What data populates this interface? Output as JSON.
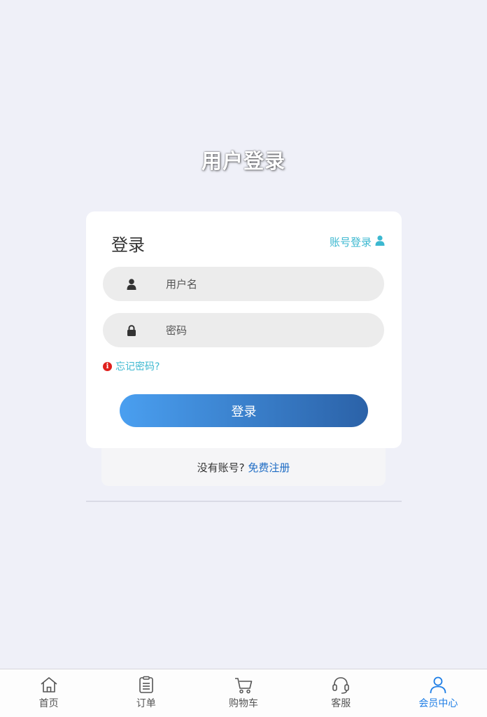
{
  "page": {
    "title": "用户登录"
  },
  "login_card": {
    "title": "登录",
    "account_login_label": "账号登录",
    "username_placeholder": "用户名",
    "password_placeholder": "密码",
    "forgot_password": "忘记密码?",
    "submit_label": "登录"
  },
  "register": {
    "prompt": "没有账号?",
    "link": "免费注册"
  },
  "tabbar": {
    "active_color": "#1e7ee6",
    "items": [
      {
        "label": "首页",
        "icon": "home-icon"
      },
      {
        "label": "订单",
        "icon": "clipboard-icon"
      },
      {
        "label": "购物车",
        "icon": "cart-icon"
      },
      {
        "label": "客服",
        "icon": "headset-icon"
      },
      {
        "label": "会员中心",
        "icon": "user-icon",
        "active": true
      }
    ]
  },
  "colors": {
    "background": "#eff0f8",
    "accent_teal": "#3cb8d0",
    "link_blue": "#1e6cc4",
    "button_gradient_start": "#4a9ff0",
    "button_gradient_end": "#2b62a8"
  }
}
